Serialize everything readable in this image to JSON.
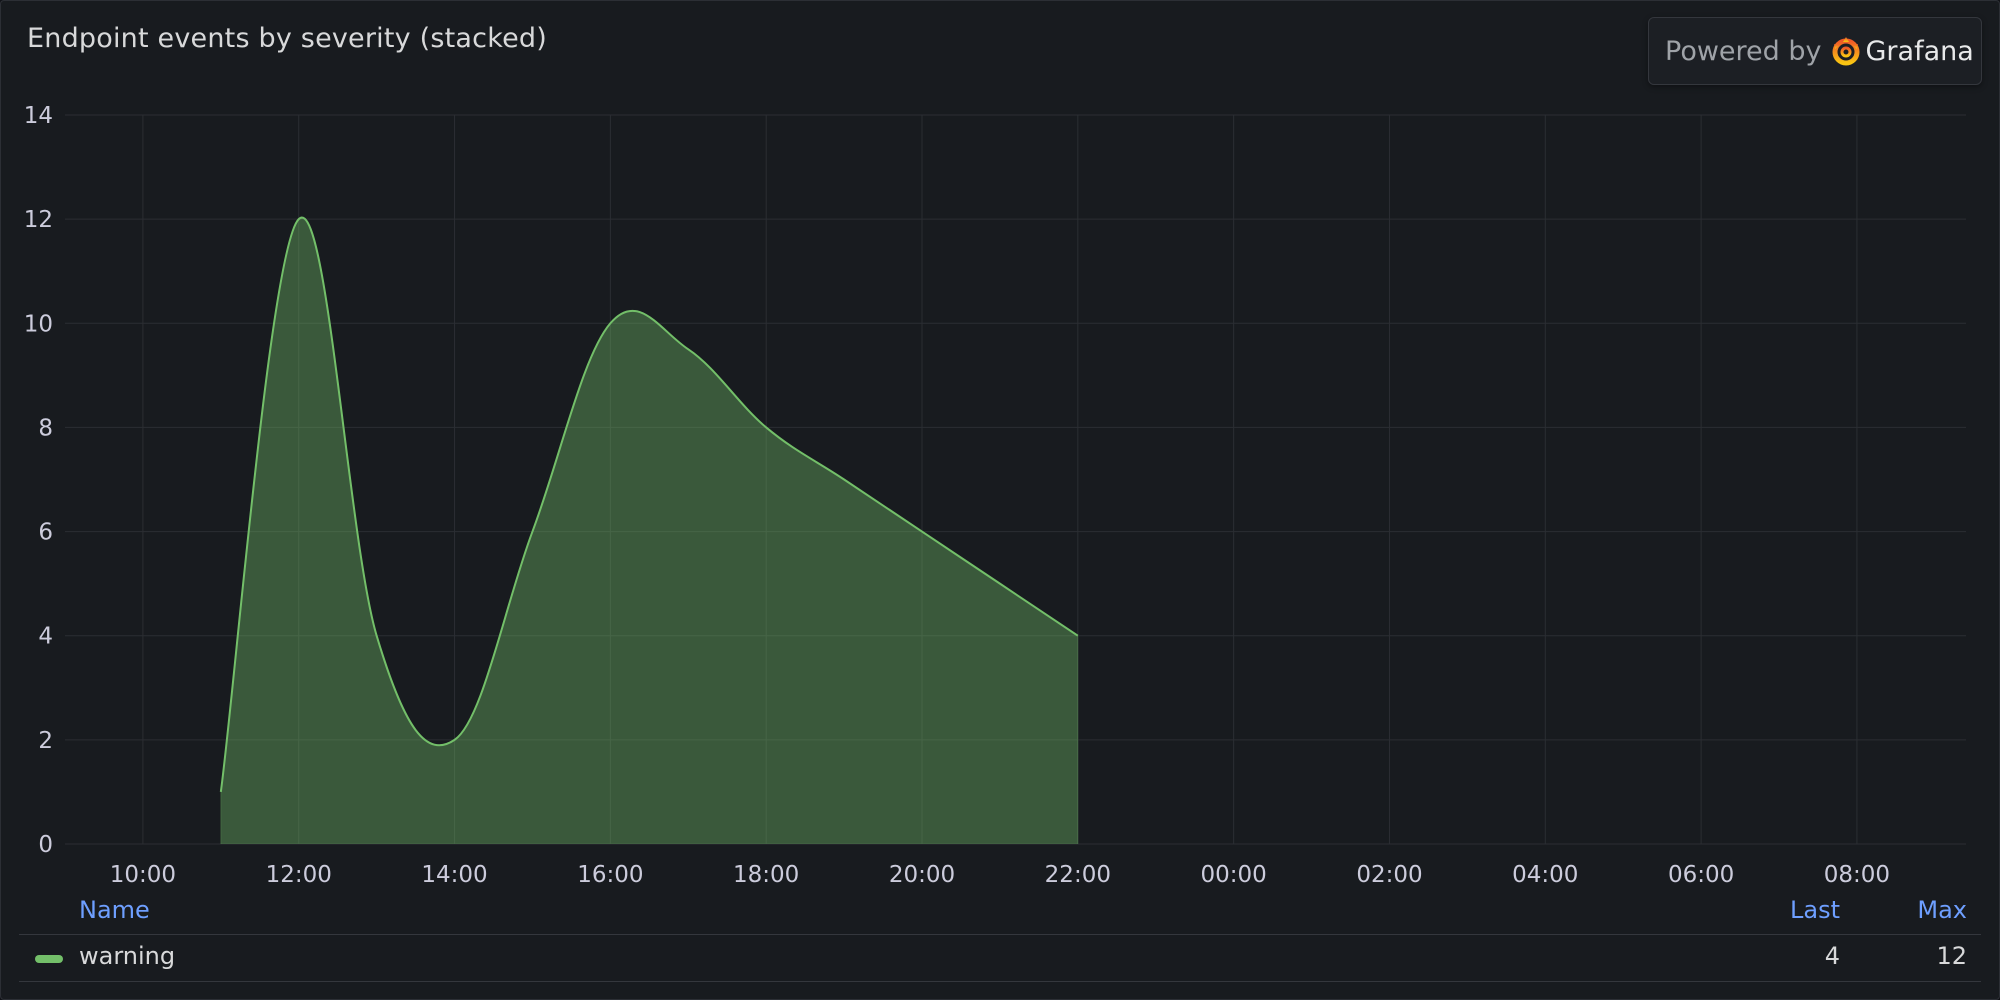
{
  "panel": {
    "title": "Endpoint events by severity (stacked)"
  },
  "branding": {
    "powered_by": "Powered by",
    "wordmark": "Grafana",
    "icon": "grafana-icon"
  },
  "legend": {
    "headers": {
      "name": "Name",
      "last": "Last",
      "max": "Max"
    },
    "rows": [
      {
        "name": "warning",
        "last": "4",
        "max": "12",
        "color": "#73bf69"
      }
    ]
  },
  "colors": {
    "background": "#181b1f",
    "series": "#73bf69",
    "accent": "#6e9fff"
  },
  "chart_data": {
    "type": "area",
    "title": "Endpoint events by severity (stacked)",
    "xlabel": "",
    "ylabel": "",
    "x_ticks": [
      "10:00",
      "12:00",
      "14:00",
      "16:00",
      "18:00",
      "20:00",
      "22:00",
      "00:00",
      "02:00",
      "04:00",
      "06:00",
      "08:00"
    ],
    "y_ticks": [
      0,
      2,
      4,
      6,
      8,
      10,
      12,
      14
    ],
    "ylim": [
      0,
      14
    ],
    "xlim_hours": [
      9.0,
      33.4
    ],
    "grid": true,
    "legend_placement": "bottom",
    "series": [
      {
        "name": "warning",
        "color": "#73bf69",
        "x": [
          "11:00",
          "12:00",
          "13:00",
          "14:00",
          "15:00",
          "16:00",
          "17:00",
          "18:00",
          "19:00",
          "20:00",
          "21:00",
          "22:00"
        ],
        "hours": [
          11,
          12,
          13,
          14,
          15,
          16,
          17,
          18,
          19,
          20,
          21,
          22
        ],
        "values": [
          1,
          12,
          4,
          2,
          6,
          10,
          9.5,
          8,
          7,
          6,
          5,
          4
        ]
      }
    ]
  }
}
